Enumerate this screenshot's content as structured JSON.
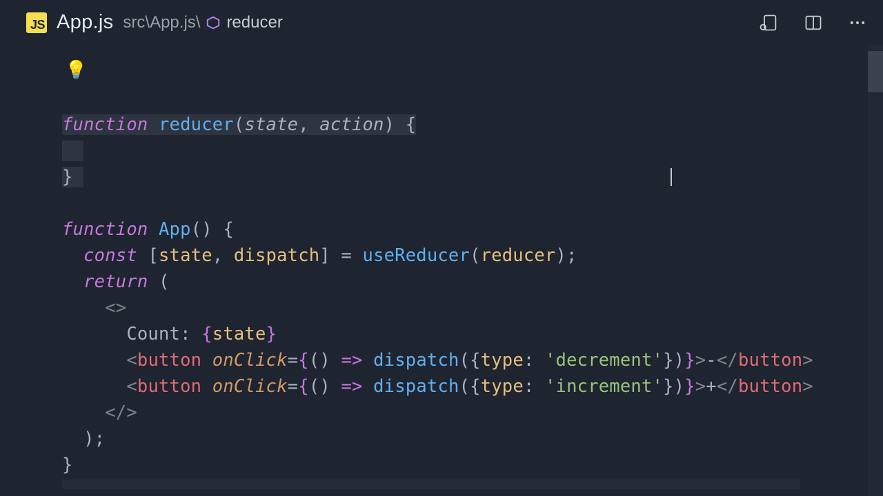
{
  "tab": {
    "lang_badge": "JS",
    "filename": "App.js"
  },
  "breadcrumb": {
    "path": "src\\App.js\\",
    "symbol": "reducer"
  },
  "icons": {
    "run_settings": "run-settings-icon",
    "split": "split-editor-icon",
    "more": "more-actions-icon",
    "lightbulb": "lightbulb-icon",
    "symbol_method": "symbol-method-icon"
  },
  "code": {
    "l1_kw": "function",
    "l1_fn": "reducer",
    "l1_p1": "state",
    "l1_p2": "action",
    "l4_kw": "function",
    "l4_fn": "App",
    "l5_kw": "const",
    "l5_v1": "state",
    "l5_v2": "dispatch",
    "l5_call": "useReducer",
    "l5_arg": "reducer",
    "l6_kw": "return",
    "l8_text": "Count: ",
    "l8_var": "state",
    "l9_tag": "button",
    "l9_attr": "onClick",
    "l9_call": "dispatch",
    "l9_key": "type",
    "l9_str": "'decrement'",
    "l9_content": "-",
    "l10_tag": "button",
    "l10_attr": "onClick",
    "l10_call": "dispatch",
    "l10_key": "type",
    "l10_str": "'increment'",
    "l10_content": "+"
  }
}
